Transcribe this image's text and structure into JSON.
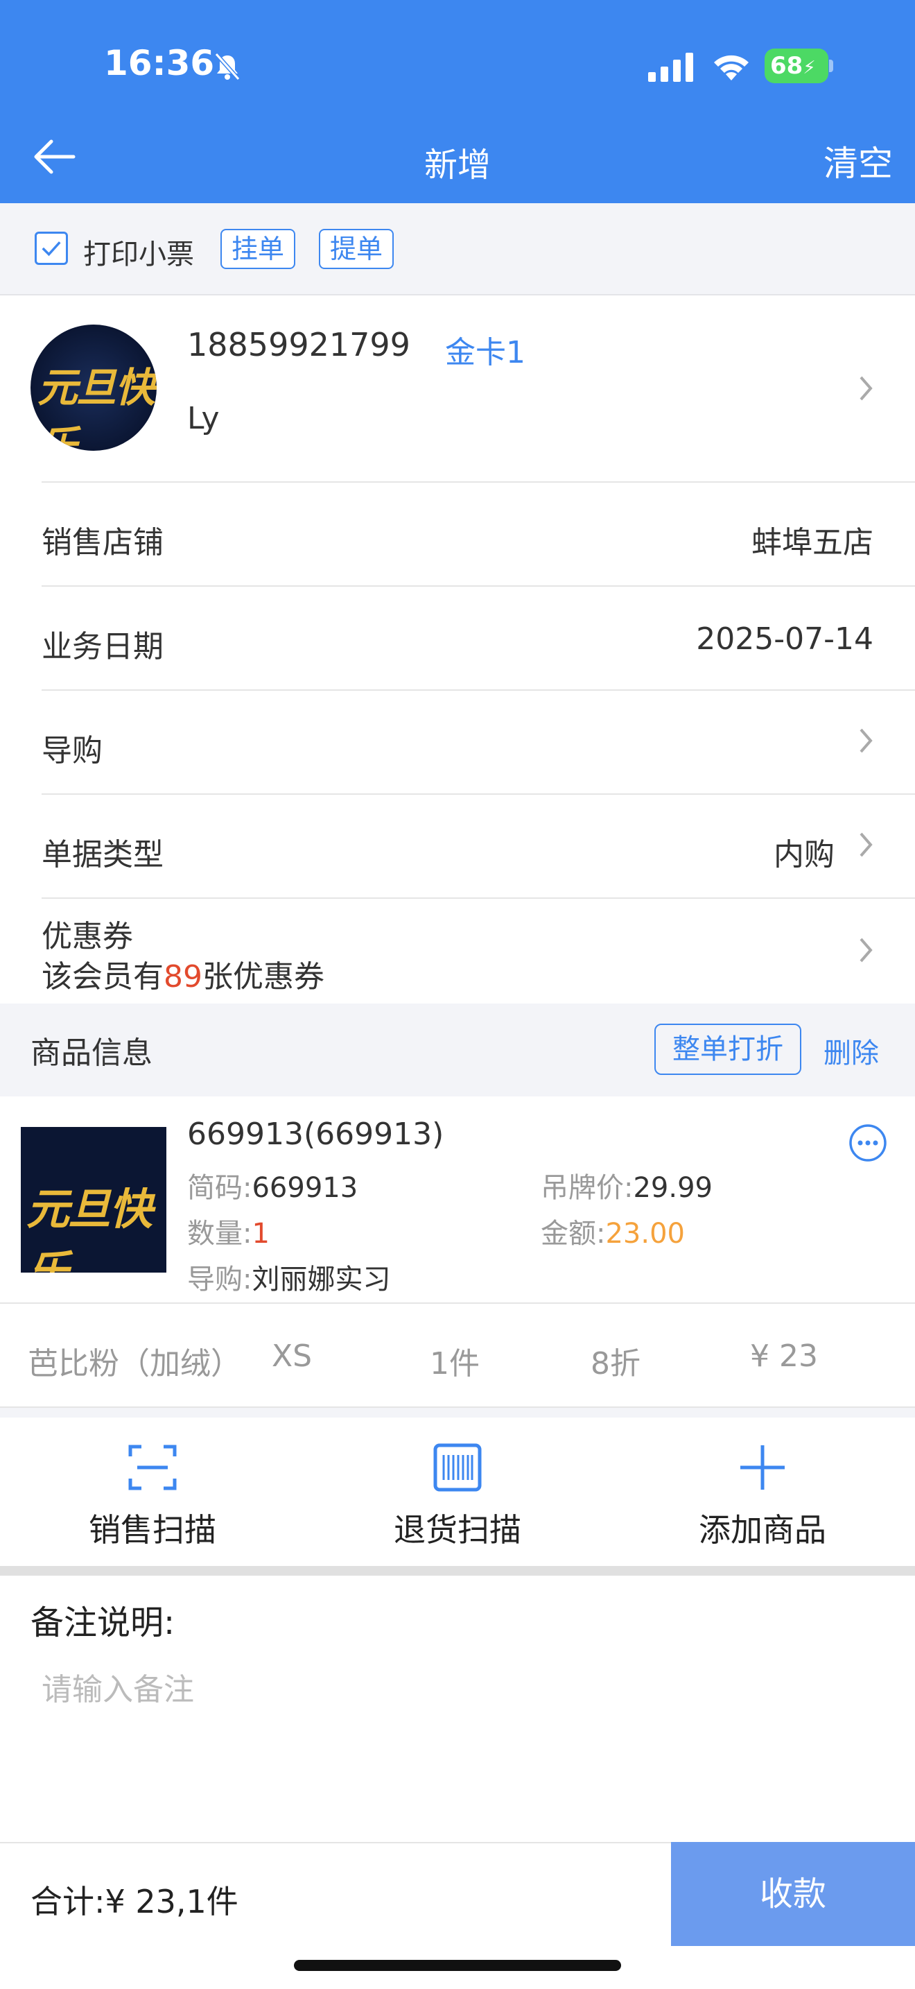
{
  "status_bar": {
    "time": "16:36",
    "battery": "68"
  },
  "nav": {
    "title": "新增",
    "clear_label": "清空"
  },
  "print_bar": {
    "print_label": "打印小票",
    "hold_label": "挂单",
    "retrieve_label": "提单",
    "print_checked": true
  },
  "member": {
    "phone": "18859921799",
    "card_level": "金卡1",
    "name": "Ly",
    "avatar_text": "元旦快乐"
  },
  "rows": {
    "store": {
      "label": "销售店铺",
      "value": "蚌埠五店"
    },
    "date": {
      "label": "业务日期",
      "value": "2025-07-14"
    },
    "guide": {
      "label": "导购"
    },
    "doc_type": {
      "label": "单据类型",
      "value": "内购"
    },
    "coupon": {
      "label": "优惠券",
      "desc_prefix": "该会员有",
      "count": "89",
      "desc_suffix": "张优惠券"
    }
  },
  "products": {
    "section_label": "商品信息",
    "discount_label": "整单打折",
    "delete_label": "删除",
    "item": {
      "code": "669913(669913)",
      "short_code_key": "简码:",
      "short_code": "669913",
      "tag_price_key": "吊牌价:",
      "tag_price": "29.99",
      "qty_key": "数量:",
      "qty": "1",
      "amount_key": "金额:",
      "amount": "23.00",
      "guide_key": "导购:",
      "guide": "刘丽娜实习",
      "thumb_text": "元旦快乐"
    },
    "sku": {
      "color": "芭比粉（加绒）",
      "size": "XS",
      "pieces": "1件",
      "discount": "8折",
      "price": "¥ 23"
    }
  },
  "actions": {
    "sale_scan": "销售扫描",
    "return_scan": "退货扫描",
    "add_product": "添加商品"
  },
  "note": {
    "label": "备注说明:",
    "placeholder": "请输入备注"
  },
  "footer": {
    "total": "合计:¥ 23,1件",
    "pay_label": "收款"
  },
  "colors": {
    "primary": "#3d87f0",
    "pay_button": "#6b9bee",
    "red": "#e24a2d",
    "orange": "#f5a23c"
  }
}
